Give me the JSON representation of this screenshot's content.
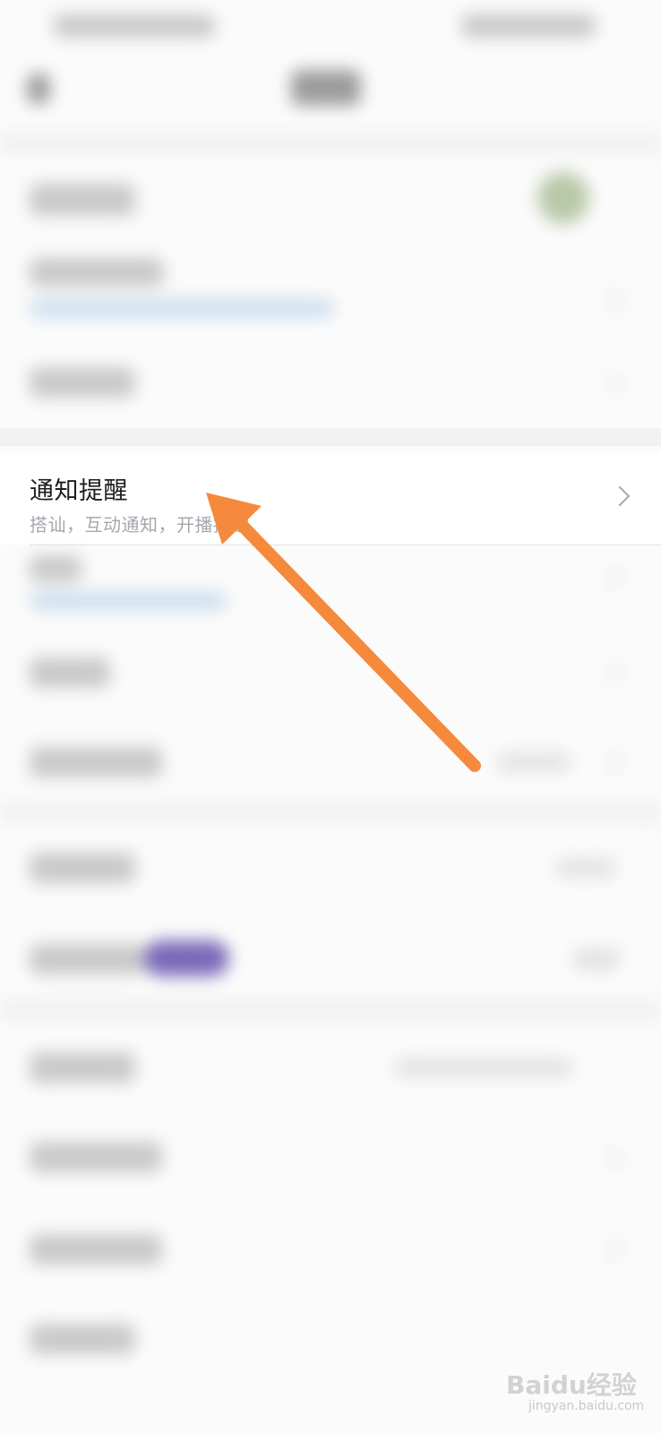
{
  "notify_row": {
    "title": "通知提醒",
    "subtitle": "搭讪，互动通知，开播提醒"
  },
  "annotation": {
    "arrow_color": "#f58a3c"
  },
  "watermark": {
    "brand": "Baidu经验",
    "url": "jingyan.baidu.com"
  },
  "colors": {
    "background": "#fbfbfb",
    "row_background": "#ffffff",
    "title_text": "#1e1e1e",
    "subtitle_text": "#a4a8ad"
  }
}
